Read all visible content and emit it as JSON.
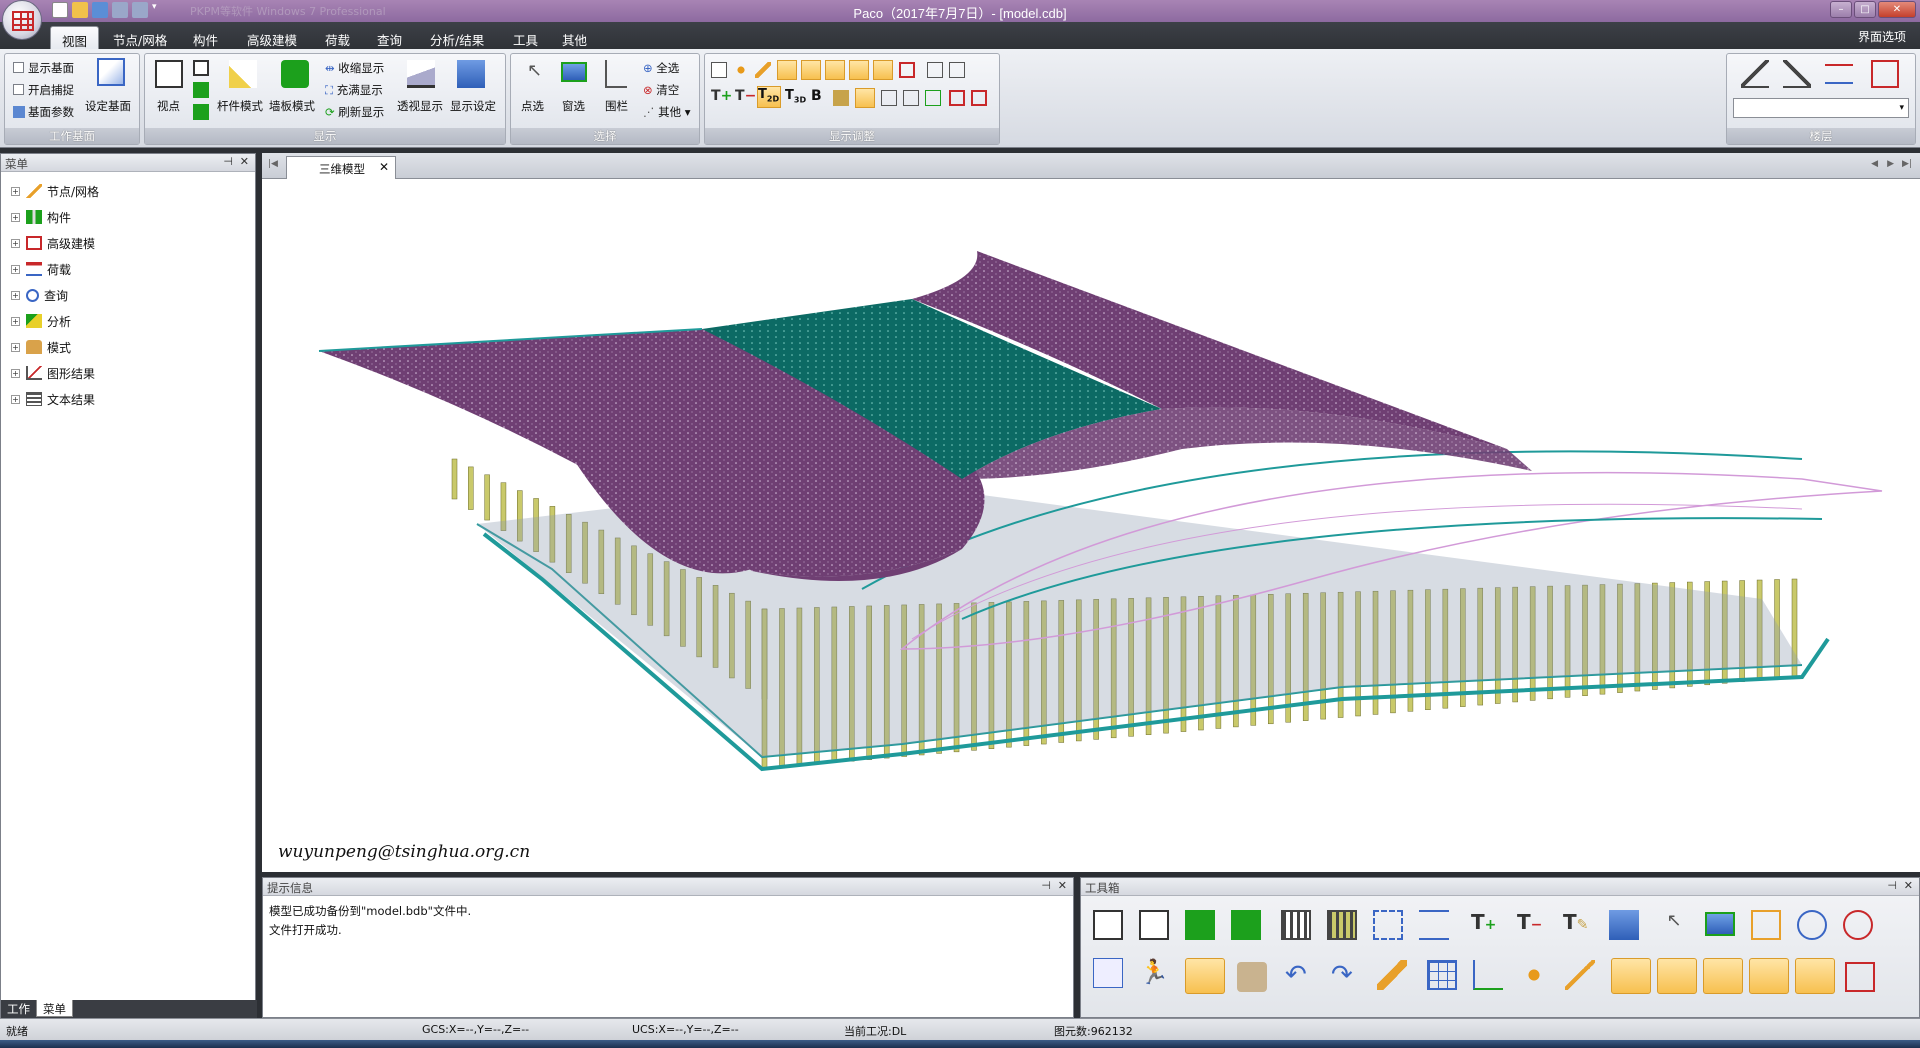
{
  "window": {
    "title": "Paco（2017年7月7日）- [model.cdb]",
    "qat_hint": "PKPM等软件 Windows 7 Professional"
  },
  "menu_tabs": [
    "视图",
    "节点/网格",
    "构件",
    "高级建模",
    "荷载",
    "查询",
    "分析/结果",
    "工具",
    "其他"
  ],
  "menu_right": "界面选项",
  "ribbon": {
    "groups": [
      "工作基面",
      "显示",
      "选择",
      "显示调整",
      "楼层"
    ],
    "workplane": {
      "show_plane": "显示基面",
      "snap": "开启捕捉",
      "plane_params": "基面参数",
      "set_plane": "设定基面"
    },
    "display": {
      "viewpoint": "视点",
      "member_mode": "杆件模式",
      "wall_mode": "墙板模式",
      "shrink": "收缩显示",
      "fill": "充满显示",
      "refresh": "刷新显示",
      "perspective": "透视显示",
      "settings": "显示设定"
    },
    "select": {
      "point": "点选",
      "window": "窗选",
      "fence": "围栏",
      "all": "全选",
      "clear": "清空",
      "other": "其他"
    }
  },
  "left_panel": {
    "title": "菜单",
    "items": [
      "节点/网格",
      "构件",
      "高级建模",
      "荷载",
      "查询",
      "分析",
      "模式",
      "图形结果",
      "文本结果"
    ],
    "bottom_tabs": [
      "工作",
      "菜单"
    ]
  },
  "document": {
    "tab": "三维模型",
    "watermark": "wuyunpeng@tsinghua.org.cn"
  },
  "info_panel": {
    "title": "提示信息",
    "lines": [
      "模型已成功备份到\"model.bdb\"文件中.",
      "文件打开成功."
    ]
  },
  "toolbox": {
    "title": "工具箱"
  },
  "status": {
    "state": "就绪",
    "gcs": "GCS:X=--,Y=--,Z=--",
    "ucs": "UCS:X=--,Y=--,Z=--",
    "case": "当前工况:DL",
    "elements": "图元数:962132"
  },
  "colors": {
    "roof": "#6f3f73",
    "roof_center": "#0c6a64",
    "beam": "#1f9a9a",
    "column": "#c9c96a",
    "truss": "#d29ad8"
  }
}
